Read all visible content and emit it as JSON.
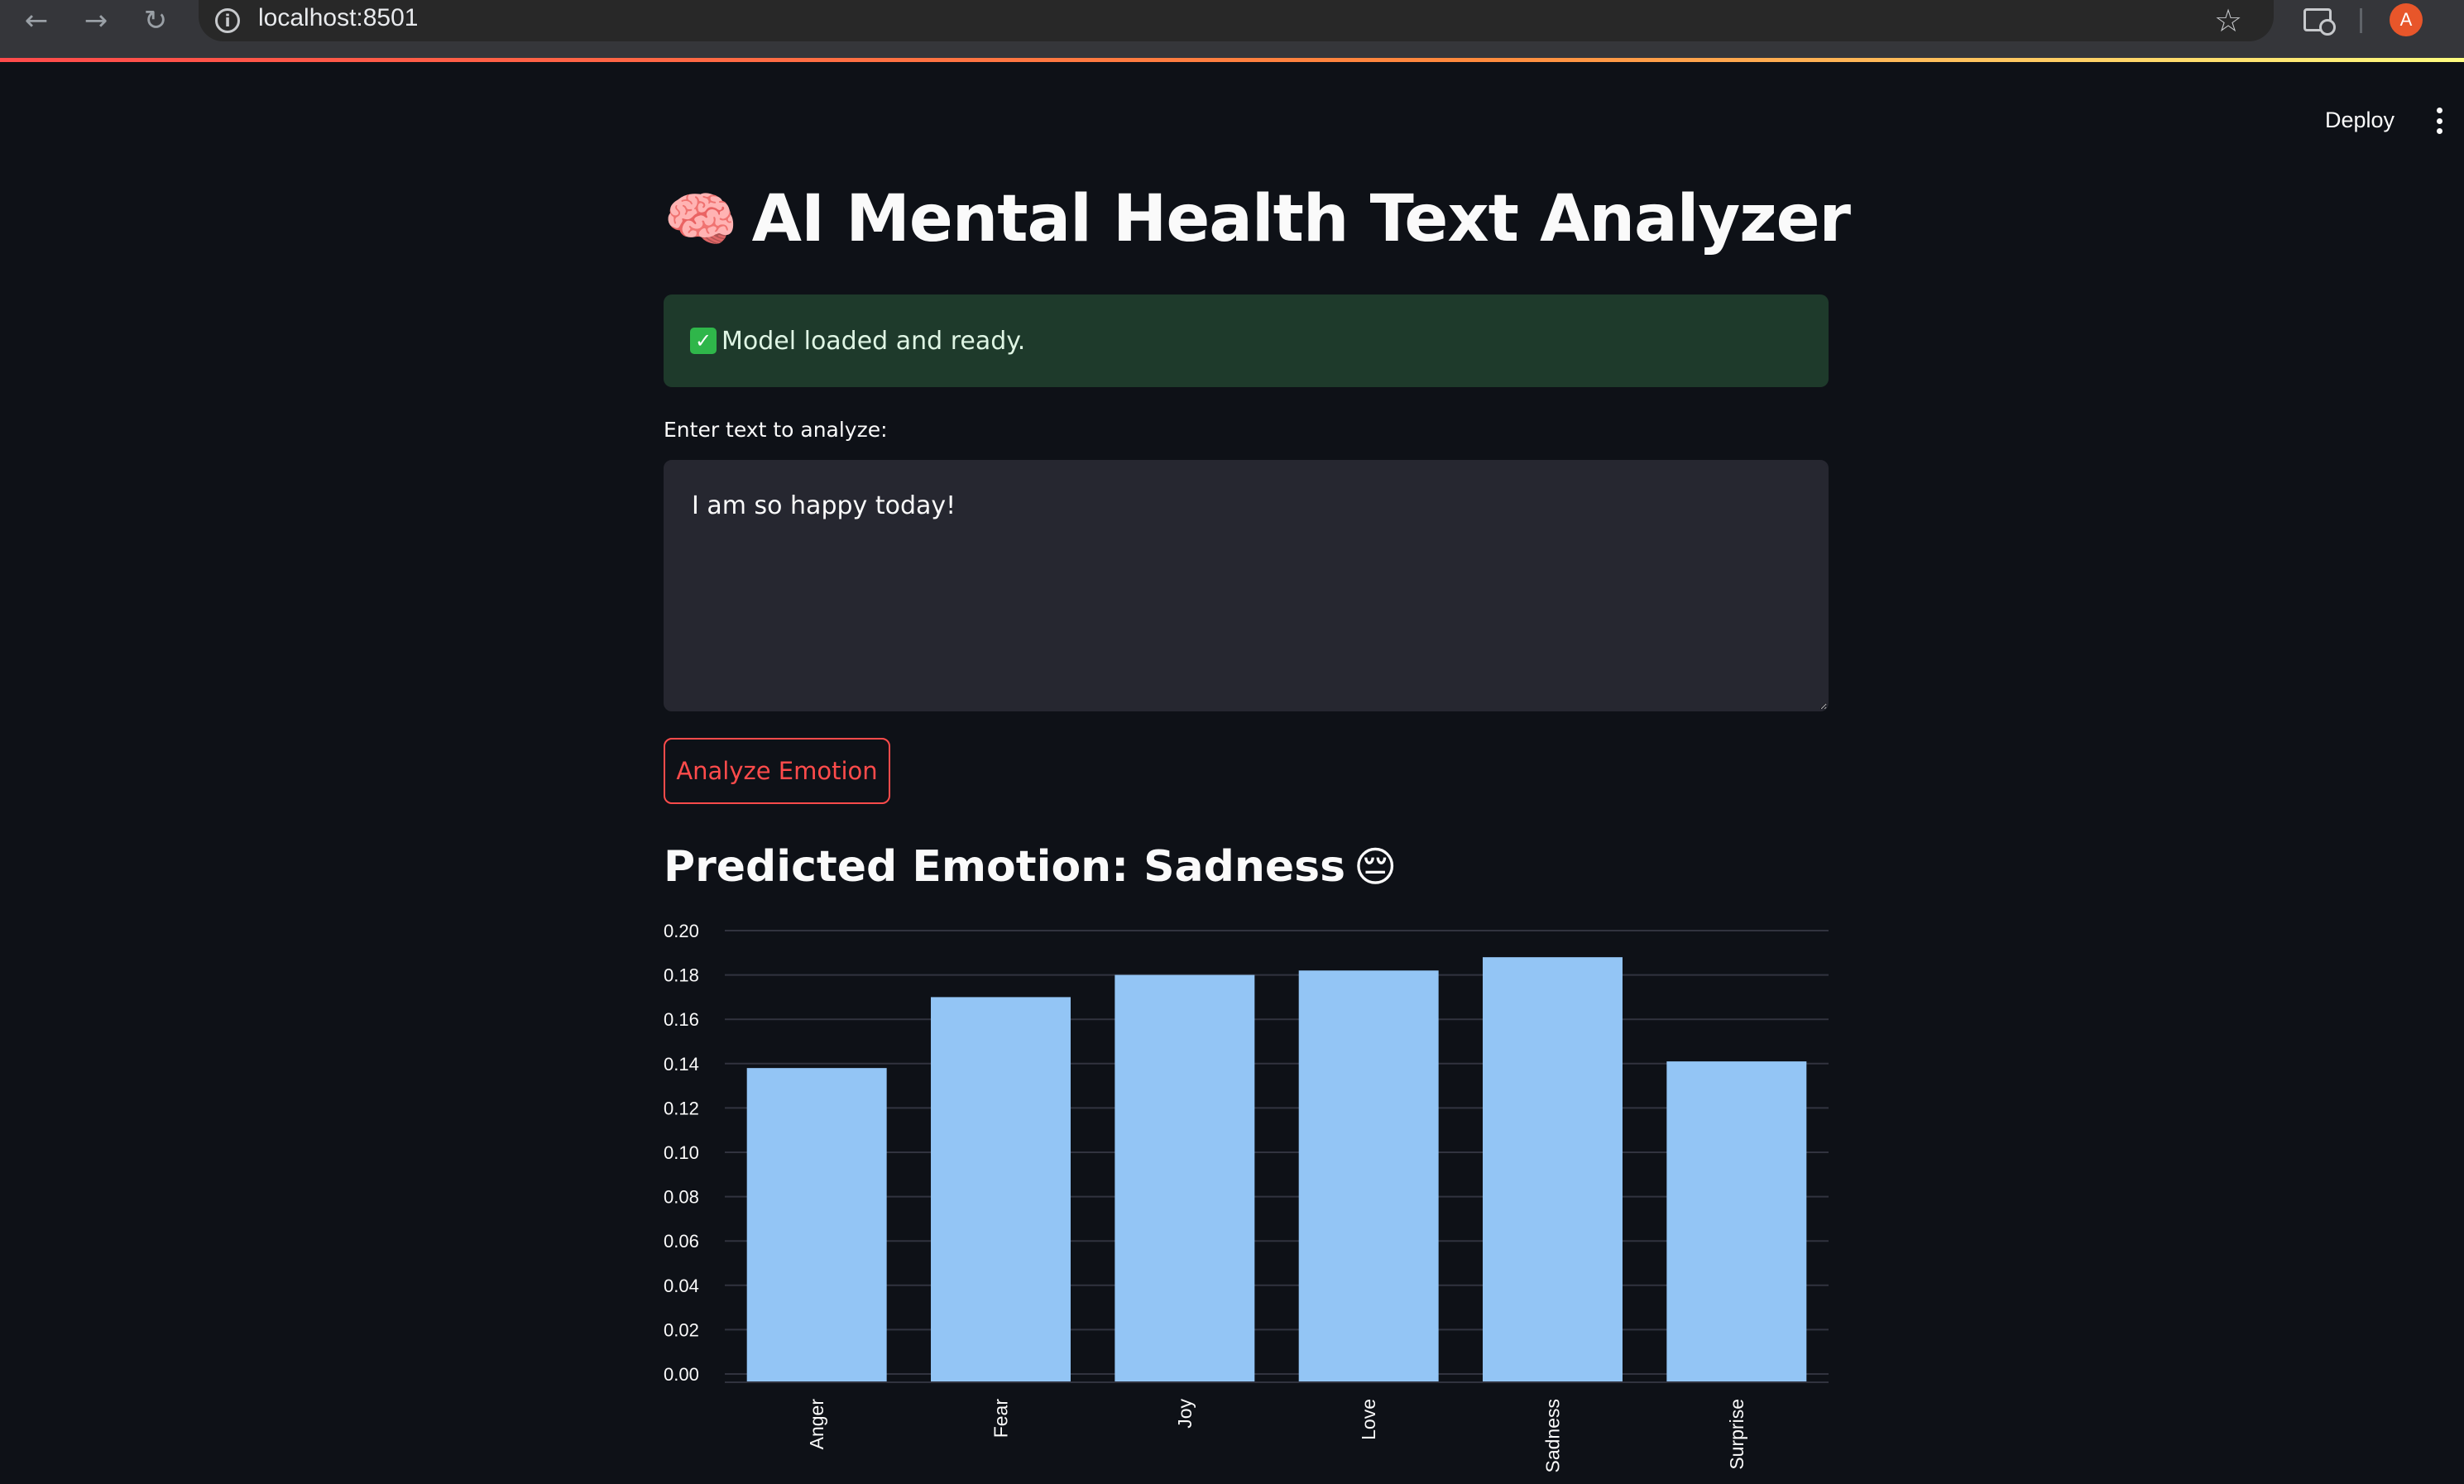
{
  "browser": {
    "url": "localhost:8501",
    "profile_initial": "A",
    "icons": [
      "back-arrow-icon",
      "forward-arrow-icon",
      "reload-icon",
      "site-info-icon",
      "bookmark-star-icon",
      "tab-search-icon"
    ]
  },
  "header": {
    "deploy_label": "Deploy",
    "menu_icon": "kebab-menu-icon"
  },
  "app": {
    "title_emoji": "🧠",
    "title": "AI Mental Health Text Analyzer",
    "status_text": "Model loaded and ready.",
    "status_icon": "check-mark-icon",
    "input_label": "Enter text to analyze:",
    "input_value": "I am so happy today!",
    "button_label": "Analyze Emotion",
    "prediction_text": "Predicted Emotion: Sadness",
    "prediction_emoji": "😔"
  },
  "colors": {
    "background": "#0e1117",
    "primary": "#ff4b4b",
    "success_bg": "#1e3a2b",
    "bar": "#93c5f5"
  },
  "chart_data": {
    "type": "bar",
    "categories": [
      "Anger",
      "Fear",
      "Joy",
      "Love",
      "Sadness",
      "Surprise"
    ],
    "values": [
      0.138,
      0.17,
      0.18,
      0.182,
      0.188,
      0.141
    ],
    "yticks": [
      "0.20",
      "0.18",
      "0.16",
      "0.14",
      "0.12",
      "0.10",
      "0.08",
      "0.06",
      "0.04",
      "0.02",
      "0.00"
    ],
    "ylim": [
      0,
      0.2
    ],
    "grid": true,
    "xlabel": "",
    "ylabel": "",
    "title": ""
  }
}
